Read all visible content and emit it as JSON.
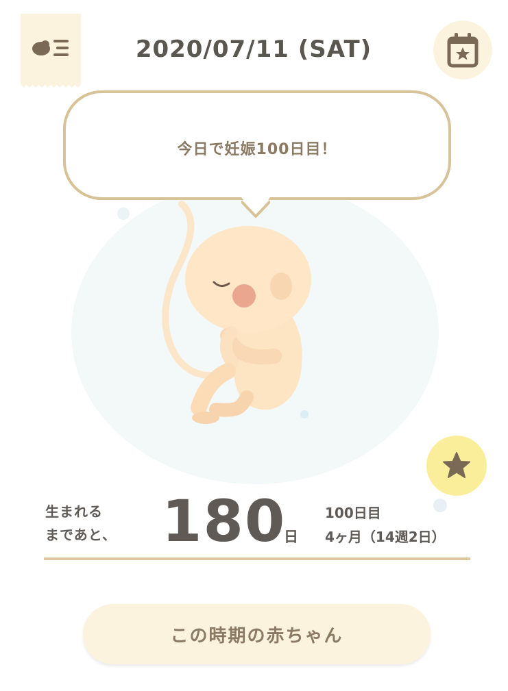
{
  "header": {
    "date": "2020/07/11 (SAT)",
    "menu_icon": "baby-list-menu-icon",
    "calendar_icon": "calendar-star-icon"
  },
  "bubble": {
    "message": "今日で妊娠100日目！"
  },
  "illustration": {
    "icon": "fetus-illustration",
    "colors": {
      "womb": "#f3f8f9",
      "skin": "#fbe3c3",
      "cheek": "#e9a78d"
    }
  },
  "favorite": {
    "icon": "star-icon",
    "color": "#fbee9a"
  },
  "countdown": {
    "label_line1": "生まれる",
    "label_line2": "まであと、",
    "days": "180",
    "unit": "日",
    "day_count": "100日目",
    "month_week": "4ヶ月（14週2日）"
  },
  "actions": {
    "baby_info_label": "この時期の赤ちゃん"
  },
  "colors": {
    "accent": "#d8c298",
    "button_bg": "#fcf3de",
    "text": "#5f5a55"
  }
}
